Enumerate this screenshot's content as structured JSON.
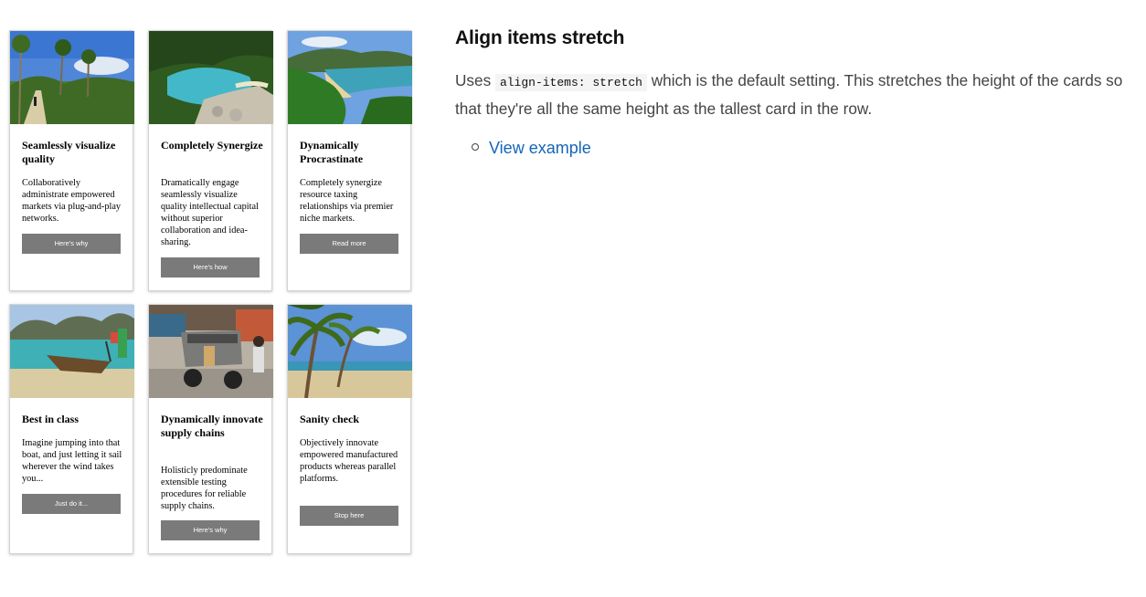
{
  "cards": [
    {
      "title": "Seamlessly visualize quality",
      "text": "Collaboratively administrate empowered markets via plug-and-play networks.",
      "button": "Here's why"
    },
    {
      "title": "Completely Synergize",
      "text": "Dramatically engage seamlessly visualize quality intellectual capital without superior collaboration and idea-sharing.",
      "button": "Here's how"
    },
    {
      "title": "Dynamically Procrastinate",
      "text": "Completely synergize resource taxing relationships via premier niche markets.",
      "button": "Read more"
    },
    {
      "title": "Best in class",
      "text": "Imagine jumping into that boat, and just letting it sail wherever the wind takes you...",
      "button": "Just do it..."
    },
    {
      "title": "Dynamically innovate supply chains",
      "text": "Holisticly predominate extensible testing procedures for reliable supply chains.",
      "button": "Here's why"
    },
    {
      "title": "Sanity check",
      "text": "Objectively innovate empowered manufactured products whereas parallel platforms.",
      "button": "Stop here"
    }
  ],
  "info": {
    "heading": "Align items stretch",
    "desc_prefix": "Uses ",
    "desc_code": "align-items: stretch",
    "desc_suffix": " which is the default setting. This stretches the height of the cards so that they're all the same height as the tallest card in the row.",
    "link_label": "View example"
  },
  "colors": {
    "button": "#7a7a7a",
    "link": "#1466b8",
    "body_text": "#444444"
  }
}
